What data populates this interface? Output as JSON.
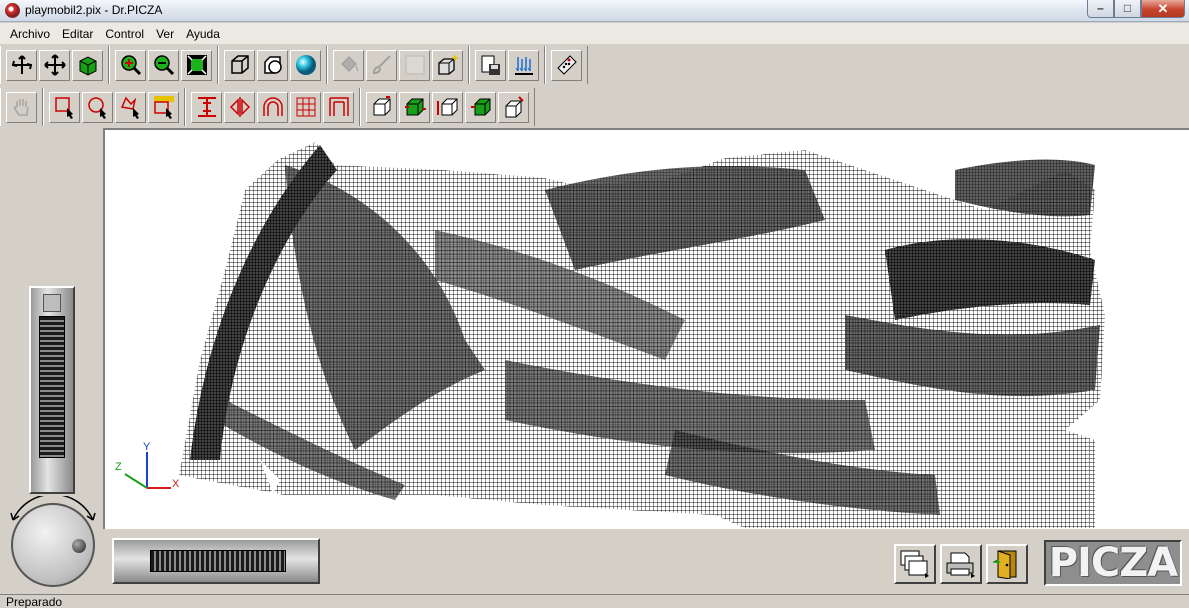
{
  "window": {
    "title": "playmobil2.pix - Dr.PICZA"
  },
  "menu": [
    "Archivo",
    "Editar",
    "Control",
    "Ver",
    "Ayuda"
  ],
  "viewport": {
    "axes": {
      "x": "X",
      "y": "Y",
      "z": "Z"
    }
  },
  "logo": {
    "text": "PICZA"
  },
  "status": {
    "text": "Preparado"
  },
  "colors": {
    "accent_cyan": "#2ec4e0",
    "zoom_green": "#1db11d",
    "close_red": "#c7442d"
  }
}
